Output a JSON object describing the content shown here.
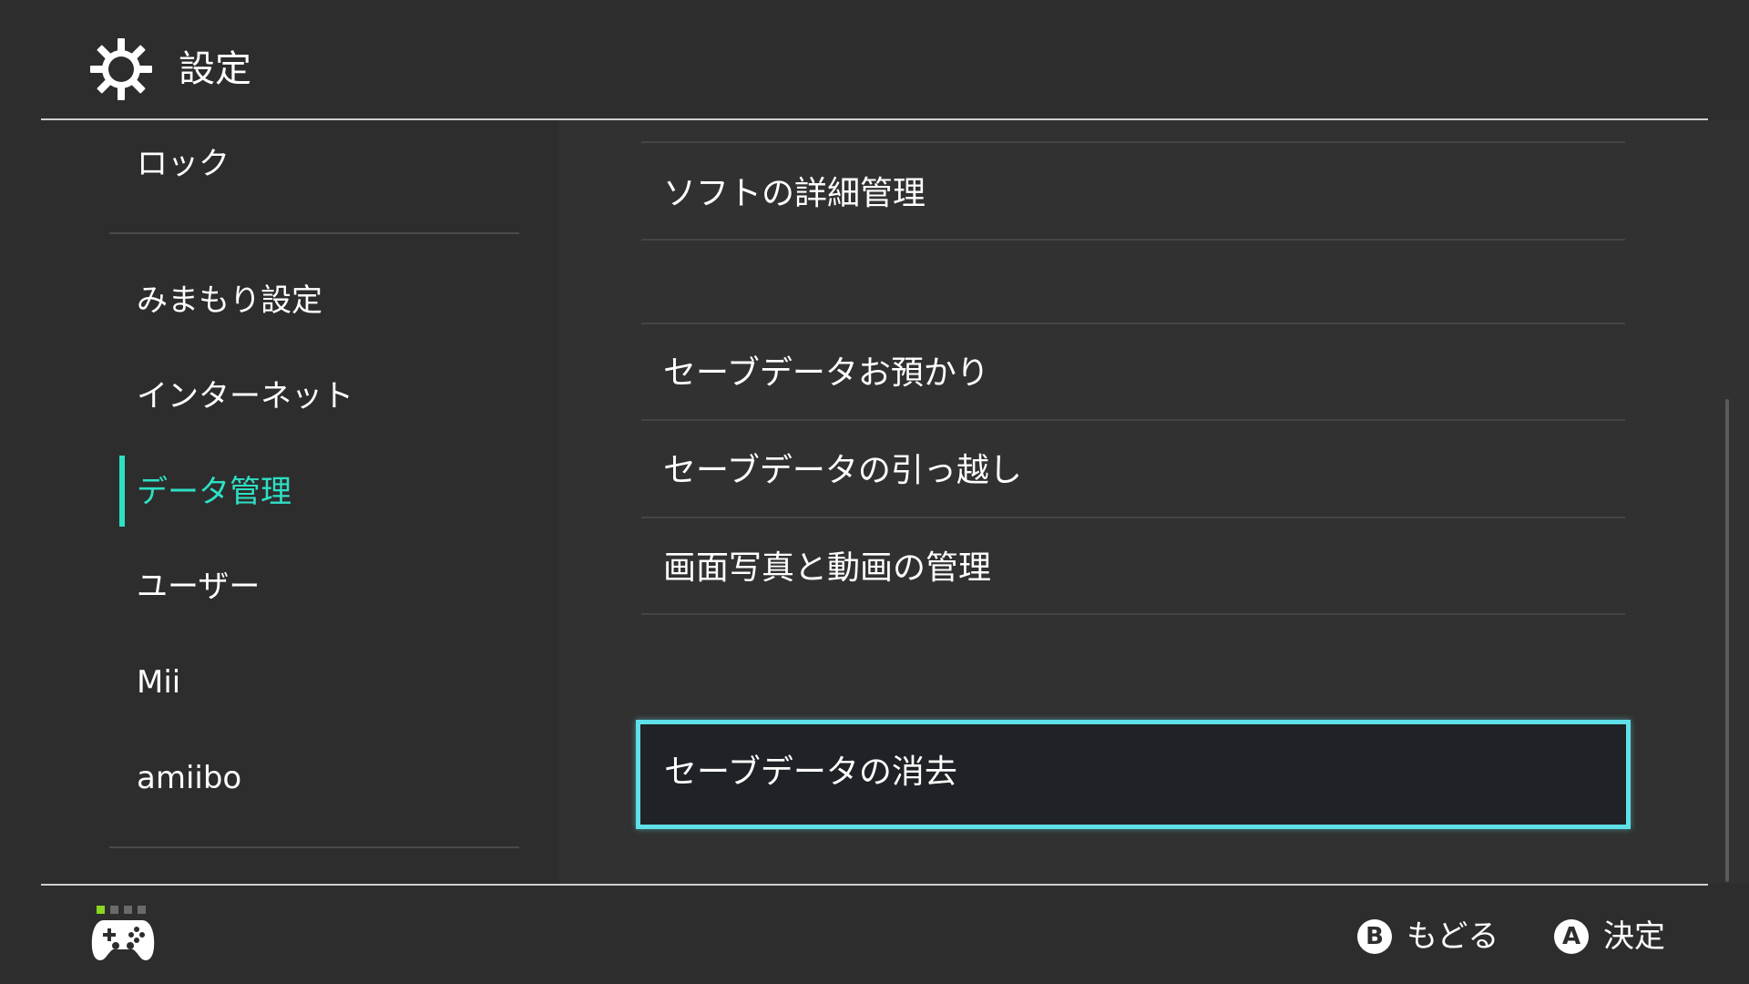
{
  "header": {
    "title": "設定",
    "icon": "gear-icon"
  },
  "sidebar": {
    "items": [
      {
        "label": "ロック"
      },
      {
        "label": "みまもり設定"
      },
      {
        "label": "インターネット"
      },
      {
        "label": "データ管理",
        "active": true
      },
      {
        "label": "ユーザー"
      },
      {
        "label": "Mii"
      },
      {
        "label": "amiibo"
      }
    ]
  },
  "main": {
    "items": [
      {
        "label": "ソフトの詳細管理"
      },
      {
        "label": "セーブデータお預かり"
      },
      {
        "label": "セーブデータの引っ越し"
      },
      {
        "label": "画面写真と動画の管理"
      },
      {
        "label": "セーブデータの消去",
        "selected": true
      }
    ]
  },
  "footer": {
    "player_indicator": {
      "active_player": 1,
      "total": 4
    },
    "back": {
      "button": "B",
      "label": "もどる"
    },
    "confirm": {
      "button": "A",
      "label": "決定"
    }
  },
  "colors": {
    "background": "#2d2d2d",
    "accent": "#2ee0c4",
    "selection_border": "#5fe0e8",
    "player_on": "#8ad621"
  }
}
